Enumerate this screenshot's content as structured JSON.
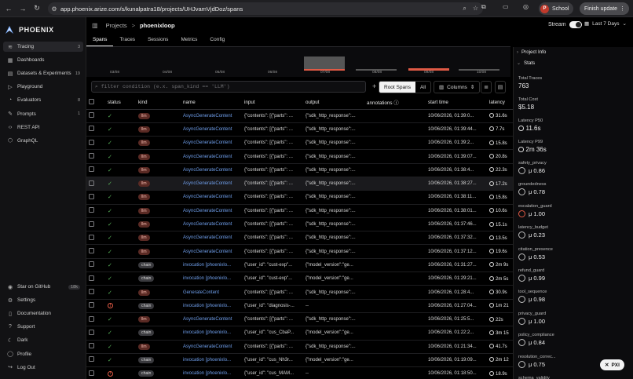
{
  "browser": {
    "url": "app.phoenix.arize.com/s/kunalpatra18/projects/UHJvamVjdDoz/spans",
    "profile_label": "School",
    "profile_initial": "P",
    "update_label": "Finish update"
  },
  "sidebar": {
    "brand": "PHOENIX",
    "items": [
      {
        "label": "Tracing",
        "count": "3",
        "icon": "tracing-icon"
      },
      {
        "label": "Dashboards",
        "count": "",
        "icon": "dashboard-icon"
      },
      {
        "label": "Datasets & Experiments",
        "count": "19",
        "icon": "database-icon"
      },
      {
        "label": "Playground",
        "count": "",
        "icon": "playground-icon"
      },
      {
        "label": "Evaluators",
        "count": "8",
        "icon": "evaluators-icon"
      },
      {
        "label": "Prompts",
        "count": "1",
        "icon": "prompts-icon"
      },
      {
        "label": "REST API",
        "count": "",
        "icon": "code-icon"
      },
      {
        "label": "GraphQL",
        "count": "",
        "icon": "graphql-icon"
      }
    ],
    "bottom": [
      {
        "label": "Star on GitHub",
        "count": "18k",
        "icon": "github-icon"
      },
      {
        "label": "Settings",
        "count": "",
        "icon": "gear-icon"
      },
      {
        "label": "Documentation",
        "count": "",
        "icon": "book-icon"
      },
      {
        "label": "Support",
        "count": "",
        "icon": "help-icon"
      },
      {
        "label": "Dark",
        "count": "",
        "icon": "moon-icon"
      },
      {
        "label": "Profile",
        "count": "",
        "icon": "user-icon"
      },
      {
        "label": "Log Out",
        "count": "",
        "icon": "logout-icon"
      }
    ]
  },
  "header": {
    "crumb_projects": "Projects",
    "crumb_sep": ">",
    "project_name": "phoenixloop",
    "stream_label": "Stream",
    "time_range": "Last 7 Days"
  },
  "tabs": [
    "Spans",
    "Traces",
    "Sessions",
    "Metrics",
    "Config"
  ],
  "histogram": {
    "ticks": [
      "03/08",
      "04/08",
      "05/08",
      "06/08",
      "07/08",
      "08/08",
      "09/08",
      "10/08"
    ]
  },
  "filter": {
    "placeholder": "filter condition (e.x. span_kind == 'LLM')",
    "root_spans_label": "Root Spans",
    "all_label": "All",
    "columns_label": "Columns"
  },
  "table": {
    "columns": [
      "status",
      "kind",
      "name",
      "input",
      "output",
      "annotations",
      "start time",
      "latency"
    ],
    "rows": [
      {
        "status": "ok",
        "kind": "llm",
        "name": "AsyncGenerateContent",
        "input": "{\"contents\": [{\"parts\": ...",
        "output": "{\"sdk_http_response\":...",
        "start": "10/06/2026, 01:39:0...",
        "latency": "31.6s"
      },
      {
        "status": "ok",
        "kind": "llm",
        "name": "AsyncGenerateContent",
        "input": "{\"contents\": [{\"parts\": ...",
        "output": "{\"sdk_http_response\":...",
        "start": "10/06/2026, 01:39:44...",
        "latency": "7.7s"
      },
      {
        "status": "ok",
        "kind": "llm",
        "name": "AsyncGenerateContent",
        "input": "{\"contents\": [{\"parts\": ...",
        "output": "{\"sdk_http_response\":...",
        "start": "10/06/2026, 01:39:2...",
        "latency": "15.8s"
      },
      {
        "status": "ok",
        "kind": "llm",
        "name": "AsyncGenerateContent",
        "input": "{\"contents\": [{\"parts\": ...",
        "output": "{\"sdk_http_response\":...",
        "start": "10/06/2026, 01:39:07...",
        "latency": "20.8s"
      },
      {
        "status": "ok",
        "kind": "llm",
        "name": "AsyncGenerateContent",
        "input": "{\"contents\": [{\"parts\": ...",
        "output": "{\"sdk_http_response\":...",
        "start": "10/06/2026, 01:38:4...",
        "latency": "22.3s"
      },
      {
        "status": "ok",
        "kind": "llm",
        "name": "AsyncGenerateContent",
        "input": "{\"contents\": [{\"parts\": ...",
        "output": "{\"sdk_http_response\":...",
        "start": "10/06/2026, 01:38:27...",
        "latency": "17.2s"
      },
      {
        "status": "ok",
        "kind": "llm",
        "name": "AsyncGenerateContent",
        "input": "{\"contents\": [{\"parts\": ...",
        "output": "{\"sdk_http_response\":...",
        "start": "10/06/2026, 01:38:11...",
        "latency": "15.8s"
      },
      {
        "status": "ok",
        "kind": "llm",
        "name": "AsyncGenerateContent",
        "input": "{\"contents\": [{\"parts\": ...",
        "output": "{\"sdk_http_response\":...",
        "start": "10/06/2026, 01:38:01...",
        "latency": "10.6s"
      },
      {
        "status": "ok",
        "kind": "llm",
        "name": "AsyncGenerateContent",
        "input": "{\"contents\": [{\"parts\": ...",
        "output": "{\"sdk_http_response\":...",
        "start": "10/06/2026, 01:37:46...",
        "latency": "15.1s"
      },
      {
        "status": "ok",
        "kind": "llm",
        "name": "AsyncGenerateContent",
        "input": "{\"contents\": [{\"parts\": ...",
        "output": "{\"sdk_http_response\":...",
        "start": "10/06/2026, 01:37:32...",
        "latency": "13.5s"
      },
      {
        "status": "ok",
        "kind": "llm",
        "name": "AsyncGenerateContent",
        "input": "{\"contents\": [{\"parts\": ...",
        "output": "{\"sdk_http_response\":...",
        "start": "10/06/2026, 01:37:12...",
        "latency": "19.6s"
      },
      {
        "status": "ok",
        "kind": "chain",
        "name": "invocation [phoenixlo...",
        "input": "{\"user_id\": \"cust-exp\"...",
        "output": "{\"model_version\":\"ge...",
        "start": "10/06/2026, 01:31:27...",
        "latency": "2m 9s"
      },
      {
        "status": "ok",
        "kind": "chain",
        "name": "invocation [phoenixlo...",
        "input": "{\"user_id\": \"cust-exp\"...",
        "output": "{\"model_version\":\"ge...",
        "start": "10/06/2026, 01:29:21...",
        "latency": "2m 5s"
      },
      {
        "status": "ok",
        "kind": "llm",
        "name": "GenerateContent",
        "input": "{\"contents\": [{\"parts\": ...",
        "output": "{\"sdk_http_response\":...",
        "start": "10/06/2026, 01:28:4...",
        "latency": "30.9s"
      },
      {
        "status": "err",
        "kind": "chain",
        "name": "invocation [phoenixlo...",
        "input": "{\"user_id\": \"diagnosis-...",
        "output": "--",
        "start": "10/06/2026, 01:27:04...",
        "latency": "1m 21"
      },
      {
        "status": "ok",
        "kind": "llm",
        "name": "AsyncGenerateContent",
        "input": "{\"contents\": [{\"parts\": ...",
        "output": "{\"sdk_http_response\":...",
        "start": "10/06/2026, 01:25:5...",
        "latency": "22s"
      },
      {
        "status": "ok",
        "kind": "chain",
        "name": "invocation [phoenixlo...",
        "input": "{\"user_id\": \"cus_CbaP...",
        "output": "{\"model_version\":\"ge...",
        "start": "10/06/2026, 01:22:2...",
        "latency": "3m 15"
      },
      {
        "status": "ok",
        "kind": "llm",
        "name": "AsyncGenerateContent",
        "input": "{\"contents\": [{\"parts\": ...",
        "output": "{\"sdk_http_response\":...",
        "start": "10/06/2026, 01:21:34...",
        "latency": "41.7s"
      },
      {
        "status": "ok",
        "kind": "chain",
        "name": "invocation [phoenixlo...",
        "input": "{\"user_id\": \"cus_Nh3r...",
        "output": "{\"model_version\":\"ge...",
        "start": "10/06/2026, 01:19:09...",
        "latency": "2m 12"
      },
      {
        "status": "err",
        "kind": "chain",
        "name": "invocation [phoenixlo...",
        "input": "{\"user_id\": \"cus_MAM...",
        "output": "--",
        "start": "10/06/2026, 01:18:50...",
        "latency": "18.9s"
      }
    ]
  },
  "right_panel": {
    "project_info_label": "Project Info",
    "stats_label": "Stats",
    "total_traces_label": "Total Traces",
    "total_traces": "763",
    "total_cost_label": "Total Cost",
    "total_cost": "$5.18",
    "p50_label": "Latency P50",
    "p50": "11.6s",
    "p99_label": "Latency P99",
    "p99": "2m 36s",
    "scores": [
      {
        "label": "safety_privacy",
        "value": "μ 0.86",
        "ring": "gray"
      },
      {
        "label": "groundedness",
        "value": "μ 0.78",
        "ring": "gray"
      },
      {
        "label": "escalation_guard",
        "value": "μ 1.00",
        "ring": "red"
      },
      {
        "label": "latency_budget",
        "value": "μ 0.23",
        "ring": "gray"
      },
      {
        "label": "citation_presence",
        "value": "μ 0.53",
        "ring": "gray"
      },
      {
        "label": "refund_guard",
        "value": "μ 0.99",
        "ring": "gray"
      },
      {
        "label": "tool_sequence",
        "value": "μ 0.98",
        "ring": "gray"
      },
      {
        "label": "privacy_guard",
        "value": "μ 1.00",
        "ring": "gray"
      },
      {
        "label": "policy_compliance",
        "value": "μ 0.84",
        "ring": "gray"
      },
      {
        "label": "resolution_correc...",
        "value": "μ 0.75",
        "ring": "gray"
      },
      {
        "label": "schema_validity",
        "value": "",
        "ring": "gray"
      }
    ],
    "pxi_label": "PXI"
  },
  "colors": {
    "accent_link": "#6f9eea",
    "ok": "#5cb85c",
    "error": "#e05a45",
    "llm_badge": "#5a2a24",
    "bar_gray": "#555555",
    "bar_red": "#e05a45"
  }
}
